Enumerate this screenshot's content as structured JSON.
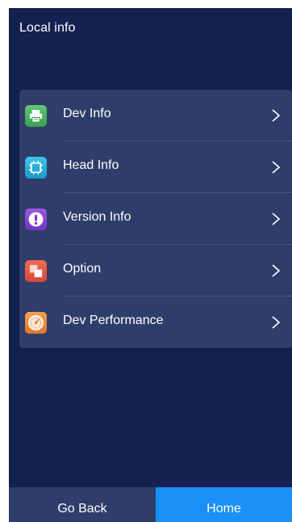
{
  "header": {
    "title": "Local info"
  },
  "menu": {
    "items": [
      {
        "label": "Dev Info",
        "icon": "printer-icon",
        "color": "#4cb564"
      },
      {
        "label": "Head Info",
        "icon": "chip-icon",
        "color": "#22b1d8"
      },
      {
        "label": "Version Info",
        "icon": "exclamation-icon",
        "color": "#8b48d3"
      },
      {
        "label": "Option",
        "icon": "layers-icon",
        "color": "#e8564a"
      },
      {
        "label": "Dev Performance",
        "icon": "speedometer-icon",
        "color": "#f08a3c"
      }
    ]
  },
  "footer": {
    "back_label": "Go Back",
    "home_label": "Home"
  },
  "colors": {
    "background": "#142150",
    "card": "#2e3d6a",
    "accent": "#1a8ff5"
  }
}
